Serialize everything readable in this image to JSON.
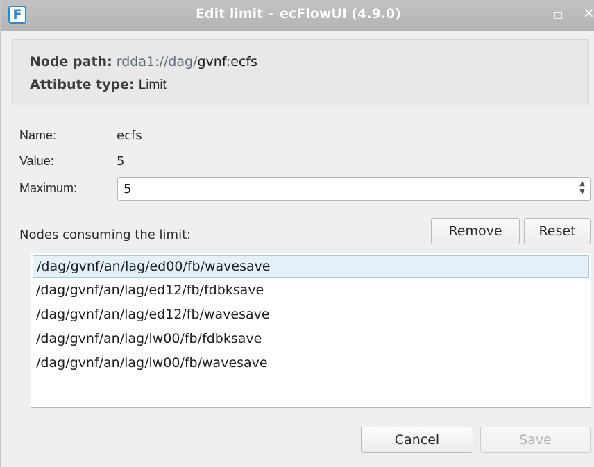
{
  "window": {
    "title_left": "Edit limit",
    "title_sep": "-",
    "title_right": "ecFlowUI (4.9.0)",
    "logo_letter": "F",
    "maximize_icon": "maximize-icon",
    "close_glyph": "✕"
  },
  "header": {
    "node_path_label": "Node path",
    "node_path_prefix": "rdda1://dag/",
    "node_path_node": "gvnf:ecfs",
    "attr_type_label": "Attibute type",
    "attr_type_value": "Limit",
    "colon": ":"
  },
  "fields": {
    "name_label": "Name:",
    "name_value": "ecfs",
    "value_label": "Value:",
    "value_value": "5",
    "maximum_label": "Maximum:",
    "maximum_value": "5"
  },
  "nodes": {
    "label": "Nodes consuming the limit:",
    "remove_label": "Remove",
    "reset_label": "Reset",
    "items": [
      "/dag/gvnf/an/lag/ed00/fb/wavesave",
      "/dag/gvnf/an/lag/ed12/fb/fdbksave",
      "/dag/gvnf/an/lag/ed12/fb/wavesave",
      "/dag/gvnf/an/lag/lw00/fb/fdbksave",
      "/dag/gvnf/an/lag/lw00/fb/wavesave"
    ],
    "selected_index": 0
  },
  "footer": {
    "cancel_mnemonic": "C",
    "cancel_rest": "ancel",
    "save_mnemonic": "S",
    "save_rest": "ave"
  },
  "colors": {
    "titlebar": "#b9b9b9",
    "selection": "#e5f0f8",
    "logo": "#2f86c9"
  }
}
